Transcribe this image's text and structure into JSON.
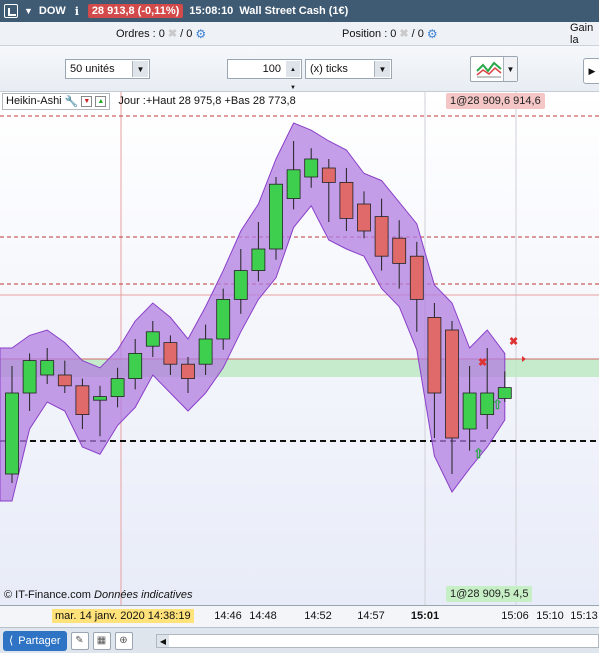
{
  "titlebar": {
    "instrument_short": "DOW",
    "price_change": "28 913,8 (-0,11%)",
    "time": "15:08:10",
    "instrument_name": "Wall Street Cash (1€)"
  },
  "orders_bar": {
    "orders_label": "Ordres :",
    "orders_value": "0",
    "orders_slash": "/ 0",
    "position_label": "Position :",
    "position_value": "0",
    "position_slash": "/ 0",
    "gain_label": "Gain la"
  },
  "toolbar": {
    "quantity_select": "50 unités",
    "distance_value": "100",
    "unit_select": "(x) ticks"
  },
  "chart": {
    "indicator_name": "Heikin-Ashi",
    "day_info": "Jour :+Haut 28 975,8 +Bas 28 773,8",
    "top_price_tag": "1@28 909,6 914,6",
    "bottom_price_tag": "1@28 909,5 4,5",
    "copyright": "© IT-Finance.com",
    "disclaimer": "Données indicatives"
  },
  "chart_data": {
    "type": "candlestick",
    "style": "heikin-ashi",
    "envelope_color": "#b27de0",
    "up_color": "#3fcf4f",
    "down_color": "#e06a6a",
    "candles": [
      {
        "o": 28865,
        "c": 28910,
        "h": 28925,
        "l": 28860,
        "dir": "up"
      },
      {
        "o": 28910,
        "c": 28928,
        "h": 28932,
        "l": 28900,
        "dir": "up"
      },
      {
        "o": 28928,
        "c": 28920,
        "h": 28935,
        "l": 28915,
        "dir": "up"
      },
      {
        "o": 28920,
        "c": 28914,
        "h": 28928,
        "l": 28910,
        "dir": "down"
      },
      {
        "o": 28914,
        "c": 28898,
        "h": 28918,
        "l": 28890,
        "dir": "down"
      },
      {
        "o": 28906,
        "c": 28908,
        "h": 28914,
        "l": 28886,
        "dir": "up"
      },
      {
        "o": 28908,
        "c": 28918,
        "h": 28924,
        "l": 28902,
        "dir": "up"
      },
      {
        "o": 28918,
        "c": 28932,
        "h": 28940,
        "l": 28912,
        "dir": "up"
      },
      {
        "o": 28936,
        "c": 28944,
        "h": 28950,
        "l": 28930,
        "dir": "up"
      },
      {
        "o": 28938,
        "c": 28926,
        "h": 28942,
        "l": 28920,
        "dir": "down"
      },
      {
        "o": 28926,
        "c": 28918,
        "h": 28930,
        "l": 28910,
        "dir": "down"
      },
      {
        "o": 28926,
        "c": 28940,
        "h": 28948,
        "l": 28920,
        "dir": "up"
      },
      {
        "o": 28940,
        "c": 28962,
        "h": 28968,
        "l": 28934,
        "dir": "up"
      },
      {
        "o": 28962,
        "c": 28978,
        "h": 28990,
        "l": 28954,
        "dir": "up"
      },
      {
        "o": 28978,
        "c": 28990,
        "h": 29005,
        "l": 28972,
        "dir": "up"
      },
      {
        "o": 28990,
        "c": 29026,
        "h": 29030,
        "l": 28984,
        "dir": "up"
      },
      {
        "o": 29018,
        "c": 29034,
        "h": 29050,
        "l": 29012,
        "dir": "up"
      },
      {
        "o": 29030,
        "c": 29040,
        "h": 29046,
        "l": 29024,
        "dir": "up"
      },
      {
        "o": 29035,
        "c": 29027,
        "h": 29040,
        "l": 29005,
        "dir": "down"
      },
      {
        "o": 29027,
        "c": 29007,
        "h": 29035,
        "l": 29000,
        "dir": "down"
      },
      {
        "o": 29015,
        "c": 29000,
        "h": 29022,
        "l": 28996,
        "dir": "down"
      },
      {
        "o": 29008,
        "c": 28986,
        "h": 29018,
        "l": 28978,
        "dir": "down"
      },
      {
        "o": 28996,
        "c": 28982,
        "h": 29006,
        "l": 28968,
        "dir": "down"
      },
      {
        "o": 28986,
        "c": 28962,
        "h": 28994,
        "l": 28944,
        "dir": "down"
      },
      {
        "o": 28952,
        "c": 28910,
        "h": 28960,
        "l": 28885,
        "dir": "down"
      },
      {
        "o": 28945,
        "c": 28885,
        "h": 28950,
        "l": 28865,
        "dir": "down"
      },
      {
        "o": 28890,
        "c": 28910,
        "h": 28925,
        "l": 28878,
        "dir": "up"
      },
      {
        "o": 28898,
        "c": 28910,
        "h": 28935,
        "l": 28890,
        "dir": "up"
      },
      {
        "o": 28907,
        "c": 28913,
        "h": 28922,
        "l": 28905,
        "dir": "up"
      }
    ],
    "price_levels": {
      "day_high": 28975.8,
      "day_low": 28773.8
    }
  }
}
